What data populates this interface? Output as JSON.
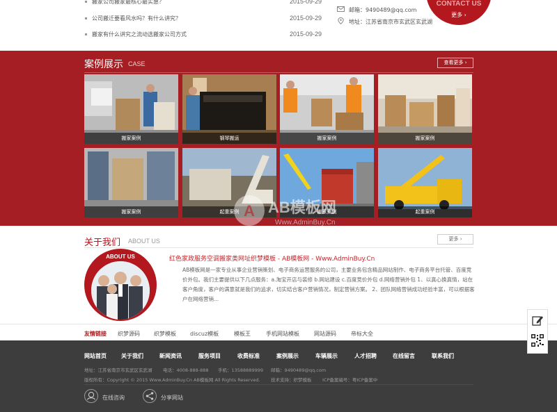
{
  "news": [
    {
      "title": "搬家公司搬家最核心最实惠？",
      "date": "2015-09-29"
    },
    {
      "title": "公司搬迁要看风水吗？有什么讲究？",
      "date": "2015-09-29"
    },
    {
      "title": "搬家有什么讲究之流动选搬家公司方式",
      "date": "2015-09-29"
    }
  ],
  "contact": {
    "email": "邮箱：9490489@qq.com",
    "address": "地址：江苏省南京市玄武区玄武湖",
    "circle_title": "CONTACT US",
    "more": "更多 ›"
  },
  "case": {
    "title": "案例展示",
    "title_en": "CASE",
    "more": "查看更多 ›",
    "items": [
      {
        "label": "搬家案例"
      },
      {
        "label": "钢琴搬运"
      },
      {
        "label": "搬家案例"
      },
      {
        "label": "搬家案例"
      },
      {
        "label": "搬家案例"
      },
      {
        "label": "起重案例"
      },
      {
        "label": "搬家案例"
      },
      {
        "label": "起重案例"
      }
    ]
  },
  "about": {
    "title": "关于我们",
    "title_en": "ABOUT US",
    "more": "更多 ›",
    "badge": "ABOUT US",
    "headline": "红色家政服务空调搬家类网址织梦模板 - AB模板网 - Www.AdminBuy.Cn",
    "text": "AB模板网是一家专业从事企业营销策划、电子商务运营服务的公司，主要业务包含精品网站制作、电子商务平台托管、百度竞价外包。我们主要提供以下几点服务：a.淘宝开店与装修 b.网站建设 c.百度竞价外包 d.网络营销外包 1、以真心换真情，站在客户角度，客户的满意就是我们的追求，切实结合客户营销情况，制定营销方案。 2、团队网络营销成功经验丰富，可以根据客户在网络营销..."
  },
  "links": {
    "label": "友情链接",
    "items": [
      "织梦源码",
      "织梦模板",
      "discuz模板",
      "模板王",
      "手机网站模板",
      "网站源码",
      "帝标大全"
    ]
  },
  "footer": {
    "nav": [
      "网站首页",
      "关于我们",
      "新闻资讯",
      "服务项目",
      "收费标准",
      "案例展示",
      "车辆展示",
      "人才招聘",
      "在线留言",
      "联系我们"
    ],
    "info1": [
      "地址：江苏省南京市玄武区玄武湖",
      "电话：4008-888-888",
      "手机：13588889999",
      "邮箱：9490489@qq.com"
    ],
    "info2": [
      "版权所有：Copyright © 2015 Www.AdminBuy.Cn AB模板网 All Rights Reserved.",
      "技术支持：织梦模板",
      "ICP备案编号：粤ICP备案中"
    ],
    "btn1": "在线咨询",
    "btn2": "分享网站"
  },
  "watermark": {
    "text1": "AB模板网",
    "text2": "Www.AdminBuy.Cn"
  },
  "colors": {
    "brand_red": "#a51e23",
    "footer_bg": "#3d3d3d"
  }
}
